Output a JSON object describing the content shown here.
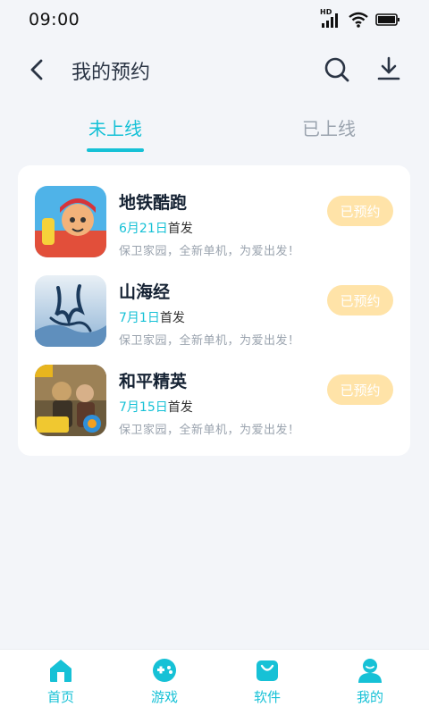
{
  "status_bar": {
    "time": "09:00",
    "network_label": "HD"
  },
  "header": {
    "title": "我的预约"
  },
  "tabs": [
    {
      "label": "未上线",
      "active": true
    },
    {
      "label": "已上线",
      "active": false
    }
  ],
  "games": [
    {
      "name": "地铁酷跑",
      "release_date": "6月21日",
      "release_suffix": "首发",
      "description": "保卫家园，全新单机，为爱出发！",
      "button_label": "已预约"
    },
    {
      "name": "山海经",
      "release_date": "7月1日",
      "release_suffix": "首发",
      "description": "保卫家园，全新单机，为爱出发！",
      "button_label": "已预约"
    },
    {
      "name": "和平精英",
      "release_date": "7月15日",
      "release_suffix": "首发",
      "description": "保卫家园，全新单机，为爱出发！",
      "button_label": "已预约"
    }
  ],
  "bottom_nav": [
    {
      "label": "首页",
      "icon": "home-icon"
    },
    {
      "label": "游戏",
      "icon": "gamepad-icon"
    },
    {
      "label": "软件",
      "icon": "bag-icon"
    },
    {
      "label": "我的",
      "icon": "user-icon"
    }
  ],
  "colors": {
    "accent": "#16c1d6",
    "reserved_button": "#ffe3a8",
    "background": "#f3f5f9"
  }
}
